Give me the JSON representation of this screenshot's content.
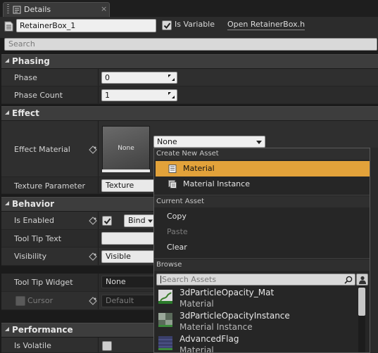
{
  "tab": {
    "title": "Details",
    "close": "×"
  },
  "header": {
    "name_value": "RetainerBox_1",
    "is_variable_label": "Is Variable",
    "is_variable_checked": true,
    "open_link": "Open RetainerBox.h"
  },
  "search": {
    "placeholder": "Search"
  },
  "categories": {
    "phasing": "Phasing",
    "effect": "Effect",
    "behavior": "Behavior",
    "performance": "Performance"
  },
  "phasing": {
    "phase_label": "Phase",
    "phase_value": "0",
    "phase_count_label": "Phase Count",
    "phase_count_value": "1"
  },
  "effect": {
    "material_label": "Effect Material",
    "thumb_text": "None",
    "combo_value": "None",
    "texture_param_label": "Texture Parameter",
    "texture_param_value": "Texture"
  },
  "behavior": {
    "is_enabled_label": "Is Enabled",
    "is_enabled_checked": true,
    "bind_label": "Bind",
    "tooltip_text_label": "Tool Tip Text",
    "visibility_label": "Visibility",
    "visibility_value": "Visible",
    "tooltip_widget_label": "Tool Tip Widget",
    "tooltip_widget_value": "None",
    "cursor_label": "Cursor",
    "cursor_value": "Default"
  },
  "performance": {
    "is_volatile_label": "Is Volatile"
  },
  "popup": {
    "create_header": "Create New Asset",
    "create_items": [
      "Material",
      "Material Instance"
    ],
    "current_header": "Current Asset",
    "current_items": [
      "Copy",
      "Paste",
      "Clear"
    ],
    "browse_header": "Browse",
    "asset_search_placeholder": "Search Assets",
    "assets": [
      {
        "name": "3dParticleOpacity_Mat",
        "type": "Material"
      },
      {
        "name": "3dParticleOpacityInstance",
        "type": "Material Instance"
      },
      {
        "name": "AdvancedFlag",
        "type": "Material"
      }
    ]
  },
  "colors": {
    "highlight": "#e2a23a",
    "panel_bg": "#2f2f2f",
    "category_bg": "#3d3d3d"
  },
  "icons": [
    "details-icon",
    "file-icon",
    "checkmark-icon",
    "collapse-arrow-icon",
    "spin-arrows-icon",
    "bind-diamond-icon",
    "dropdown-arrow-icon",
    "material-icon",
    "material-instance-icon",
    "search-icon",
    "person-icon"
  ]
}
